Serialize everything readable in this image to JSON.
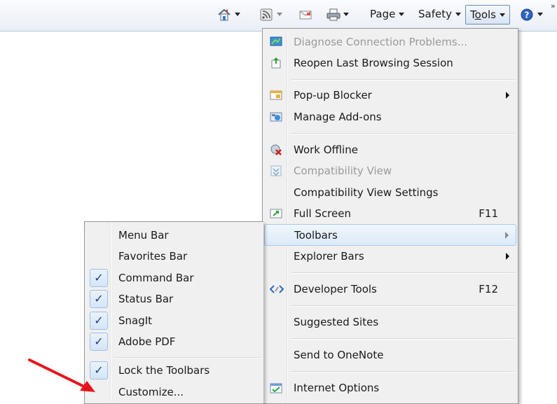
{
  "command_bar": {
    "home_icon": "home-icon",
    "feeds_icon": "feeds-icon",
    "mail_icon": "read-mail-icon",
    "print_icon": "print-icon",
    "page_label": "Page",
    "page_underline": "P",
    "safety_label": "Safety",
    "safety_underline": "S",
    "tools_label_pre": "T",
    "tools_label_u": "o",
    "tools_label_post": "ols",
    "help_icon": "help-icon"
  },
  "tools_menu": {
    "items": [
      {
        "label": "Diagnose Connection Problems...",
        "icon": "diagnose-icon",
        "disabled": true
      },
      {
        "label": "Reopen Last Browsing Session",
        "icon": "reopen-icon"
      },
      {
        "label": "Pop-up Blocker",
        "icon": "popup-blocker-icon",
        "submenu": true
      },
      {
        "label": "Manage Add-ons",
        "icon": "addons-icon"
      },
      {
        "label": "Work Offline",
        "icon": "work-offline-icon"
      },
      {
        "label": "Compatibility View",
        "icon": "compat-view-icon",
        "disabled": true
      },
      {
        "label": "Compatibility View Settings"
      },
      {
        "label": "Full Screen",
        "icon": "fullscreen-icon",
        "shortcut": "F11"
      },
      {
        "label": "Toolbars",
        "submenu": true,
        "highlighted": true
      },
      {
        "label": "Explorer Bars",
        "submenu": true
      },
      {
        "label": "Developer Tools",
        "icon": "developer-tools-icon",
        "shortcut": "F12"
      },
      {
        "label": "Suggested Sites"
      },
      {
        "label": "Send to OneNote"
      },
      {
        "label": "Internet Options",
        "icon": "internet-options-icon"
      }
    ]
  },
  "toolbars_submenu": {
    "items": [
      {
        "label": "Menu Bar",
        "checked": false
      },
      {
        "label": "Favorites Bar",
        "checked": false
      },
      {
        "label": "Command Bar",
        "checked": true
      },
      {
        "label": "Status Bar",
        "checked": true
      },
      {
        "label": "SnagIt",
        "checked": true
      },
      {
        "label": "Adobe PDF",
        "checked": true
      },
      {
        "label": "Lock the Toolbars",
        "checked": true
      },
      {
        "label": "Customize...",
        "checked": false
      }
    ],
    "check_glyph": "✓"
  },
  "annotation": {
    "arrow_color": "#e8141b"
  }
}
